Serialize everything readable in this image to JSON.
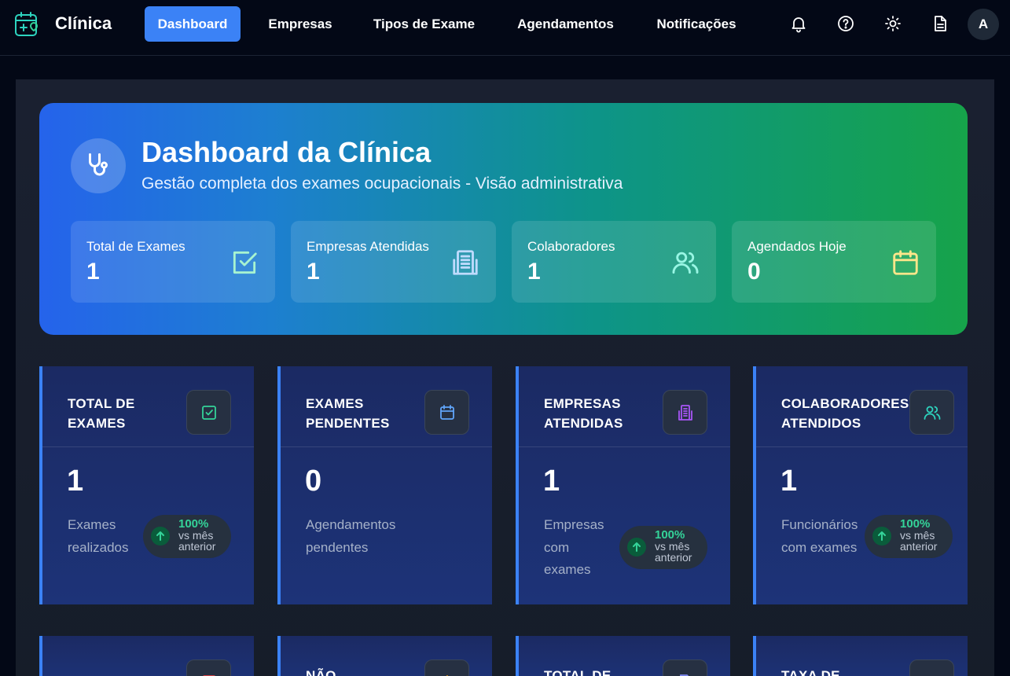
{
  "app": {
    "title": "Clínica",
    "colors": {
      "accent": "#3b82f6",
      "background": "#030816",
      "success": "#34d399"
    }
  },
  "nav": {
    "items": [
      {
        "label": "Dashboard",
        "active": true
      },
      {
        "label": "Empresas",
        "active": false
      },
      {
        "label": "Tipos de Exame",
        "active": false
      },
      {
        "label": "Agendamentos",
        "active": false
      },
      {
        "label": "Notificações",
        "active": false
      }
    ],
    "icons": [
      "bell-icon",
      "help-icon",
      "sun-icon",
      "document-icon"
    ],
    "avatar_initial": "A"
  },
  "hero": {
    "title": "Dashboard da Clínica",
    "subtitle": "Gestão completa dos exames ocupacionais - Visão administrativa",
    "icon": "stethoscope-icon",
    "stats": [
      {
        "label": "Total de Exames",
        "value": "1",
        "icon": "check-square-icon"
      },
      {
        "label": "Empresas Atendidas",
        "value": "1",
        "icon": "building-icon"
      },
      {
        "label": "Colaboradores",
        "value": "1",
        "icon": "users-icon"
      },
      {
        "label": "Agendados Hoje",
        "value": "0",
        "icon": "calendar-icon"
      }
    ]
  },
  "cards": [
    {
      "title": "TOTAL DE EXAMES",
      "value": "1",
      "description": "Exames realizados",
      "icon": "check-square-icon",
      "icon_color": "#34d399",
      "trend": {
        "percent": "100%",
        "label": "vs mês anterior"
      }
    },
    {
      "title": "EXAMES PENDENTES",
      "value": "0",
      "description": "Agendamentos pendentes",
      "icon": "calendar-icon",
      "icon_color": "#60a5fa",
      "trend": null
    },
    {
      "title": "EMPRESAS ATENDIDAS",
      "value": "1",
      "description": "Empresas com exames",
      "icon": "building-icon",
      "icon_color": "#a855f7",
      "trend": {
        "percent": "100%",
        "label": "vs mês anterior"
      }
    },
    {
      "title": "COLABORADORES ATENDIDOS",
      "value": "1",
      "description": "Funcionários com exames",
      "icon": "users-icon",
      "icon_color": "#2dd4bf",
      "trend": {
        "percent": "100%",
        "label": "vs mês anterior"
      }
    }
  ],
  "cards_row2": [
    {
      "title": "",
      "icon": "alert-icon",
      "icon_color": "#ef4444"
    },
    {
      "title": "NÃO",
      "icon": "warning-icon",
      "icon_color": "#f59e0b"
    },
    {
      "title": "TOTAL DE",
      "icon": "file-icon",
      "icon_color": "#818cf8"
    },
    {
      "title": "TAXA DE",
      "icon": "trending-icon",
      "icon_color": "#22c55e"
    }
  ]
}
